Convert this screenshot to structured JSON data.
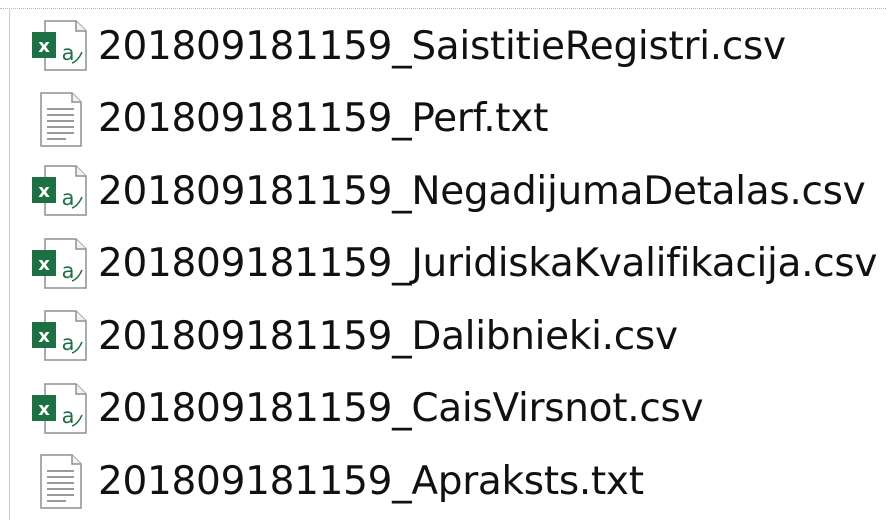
{
  "files": [
    {
      "name": "201809181159_SaistitieRegistri.csv",
      "icon": "excel-csv-icon"
    },
    {
      "name": "201809181159_Perf.txt",
      "icon": "text-file-icon"
    },
    {
      "name": "201809181159_NegadijumaDetalas.csv",
      "icon": "excel-csv-icon"
    },
    {
      "name": "201809181159_JuridiskaKvalifikacija.csv",
      "icon": "excel-csv-icon"
    },
    {
      "name": "201809181159_Dalibnieki.csv",
      "icon": "excel-csv-icon"
    },
    {
      "name": "201809181159_CaisVirsnot.csv",
      "icon": "excel-csv-icon"
    },
    {
      "name": "201809181159_Apraksts.txt",
      "icon": "text-file-icon"
    }
  ],
  "colors": {
    "excel_green": "#1d7044",
    "text": "#111111",
    "icon_border": "#8f8f8f"
  }
}
